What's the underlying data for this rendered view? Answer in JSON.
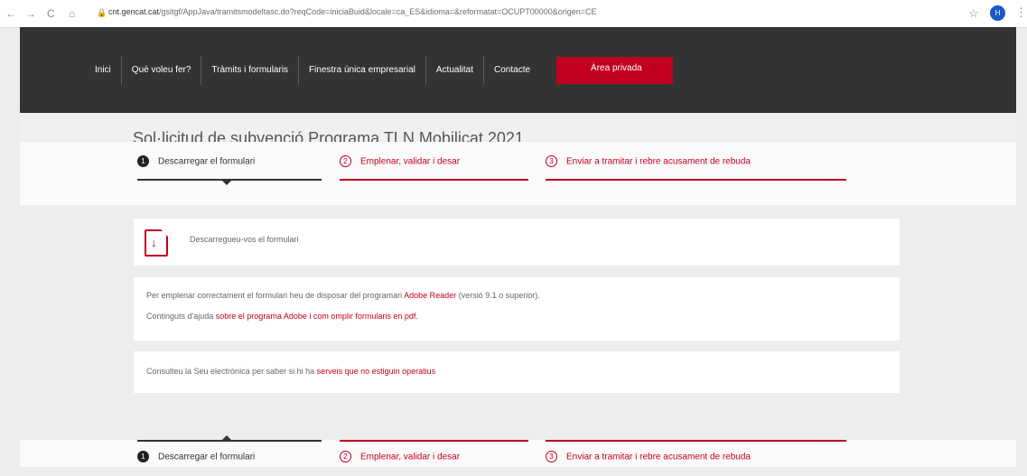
{
  "browser": {
    "back": "←",
    "forward": "→",
    "reload": "C",
    "home": "⌂",
    "url_host": "cnt.gencat.cat",
    "url_rest": "/gsitgf/AppJava/tramitsmodeltasc.do?reqCode=iniciaBuid&locale=ca_ES&idioma=&reformatat=OCUPT00000&origen=CE",
    "profile_initial": "H"
  },
  "nav": {
    "items": [
      "Inici",
      "Què voleu fer?",
      "Tràmits i formularis",
      "Finestra única empresarial",
      "Actualitat",
      "Contacte"
    ],
    "private_area": "Àrea privada"
  },
  "page": {
    "title": "Sol·licitud de subvenció Programa TLN Mobilicat 2021"
  },
  "steps": [
    {
      "num": "1",
      "label": "Descarregar el formulari",
      "state": "active"
    },
    {
      "num": "2",
      "label": "Emplenar, validar i desar",
      "state": "inactive"
    },
    {
      "num": "3",
      "label": "Enviar a tramitar i rebre acusament de rebuda",
      "state": "inactive"
    }
  ],
  "download_card": {
    "link_text": "Descarregueu-vos el formulari"
  },
  "help_card": {
    "line1_prefix": "Per emplenar correctament el formulari heu de disposar del programari ",
    "line1_link": "Adobe Reader",
    "line1_suffix": " (versió 9.1 o superior).",
    "line2_prefix": "Continguts d'ajuda ",
    "line2_link": "sobre el programa Adobe i com omplir formularis en pdf."
  },
  "status_card": {
    "prefix": "Consulteu la Seu electrònica per saber si hi ha ",
    "link": "serveis que no estiguin operatius"
  },
  "colors": {
    "accent": "#c1001f",
    "topbar": "#333333",
    "background": "#ededed"
  }
}
